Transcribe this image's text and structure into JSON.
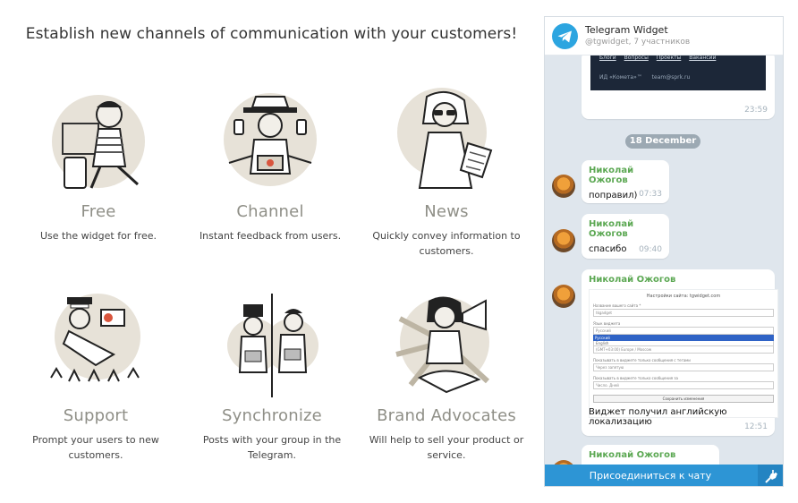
{
  "hero_title": "Establish new channels of communication with your customers!",
  "features": [
    {
      "name": "Free",
      "desc": "Use the widget for free.",
      "icon": "person-with-suitcase-icon"
    },
    {
      "name": "Channel",
      "desc": "Instant feedback from users.",
      "icon": "multitasking-hat-person-icon"
    },
    {
      "name": "News",
      "desc": "Quickly convey information to customers.",
      "icon": "woman-reading-newspaper-icon"
    },
    {
      "name": "Support",
      "desc": "Prompt your users to new customers.",
      "icon": "cameraman-with-crowd-icon"
    },
    {
      "name": "Synchronize",
      "desc": "Posts with your group in the Telegram.",
      "icon": "two-people-with-laptops-icon"
    },
    {
      "name": "Brand Advocates",
      "desc": "Will help to sell your product or service.",
      "icon": "woman-with-megaphone-icon"
    }
  ],
  "widget": {
    "title": "Telegram Widget",
    "subtitle": "@tgwidget, 7 участников",
    "accent": "#2d95d5",
    "messages": [
      {
        "type": "preview",
        "links": [
          "Блоги",
          "Вопросы",
          "Проекты",
          "Вакансии"
        ],
        "footer": [
          "ИД «Комета»™",
          "team@sprk.ru"
        ],
        "time": "23:59"
      },
      {
        "type": "date",
        "label": "18 December"
      },
      {
        "type": "text",
        "author": "Николай Ожогов",
        "text": "поправил)",
        "time": "07:33"
      },
      {
        "type": "text",
        "author": "Николай Ожогов",
        "text": "спасибо",
        "time": "09:40"
      },
      {
        "type": "image",
        "author": "Николай Ожогов",
        "shot": {
          "heading": "Настройки сайта: tgwidget.com",
          "field1_label": "Название вашего сайта *",
          "field1_value": "tkgadget",
          "lang_label": "Язык виджета",
          "lang_open": "Русский",
          "lang_options": [
            "Русский",
            "English"
          ],
          "tz_value": "(GMT+03:00) Europe / Moscow",
          "field3_label": "Показывать в виджете только сообщения с тегами",
          "field3_ph": "Через запятую",
          "field4_label": "Показывать в виджете только сообщения за",
          "field4_ph": "Число. Дней",
          "save": "Сохранить изменения"
        },
        "text": "Виджет получил английскую локализацию",
        "time": "12:51"
      },
      {
        "type": "text",
        "author": "Николай Ожогов",
        "text": "",
        "time": ""
      }
    ],
    "join_label": "Присоединиться к чату"
  }
}
